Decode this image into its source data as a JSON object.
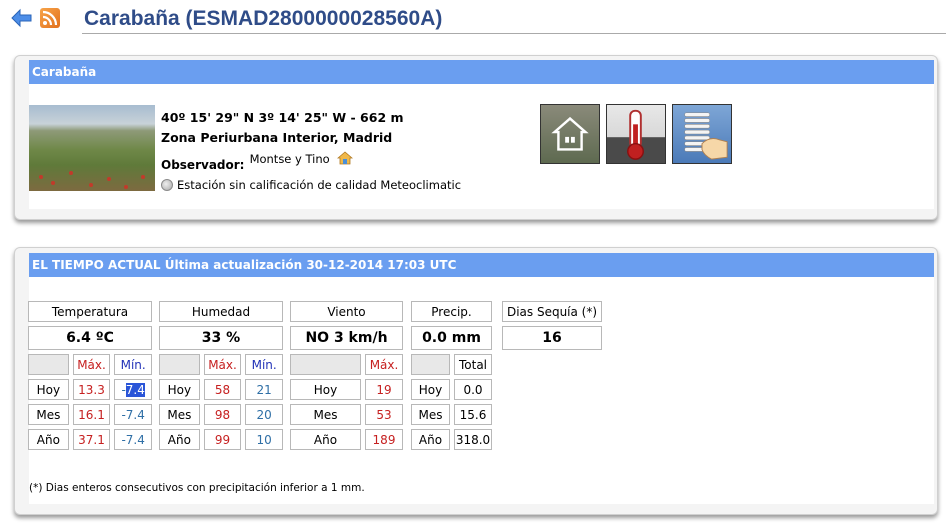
{
  "header": {
    "title": "Carabaña (ESMAD2800000028560A)",
    "back_icon": "back-arrow-icon",
    "rss_icon": "rss-feed-icon"
  },
  "station": {
    "panel_title": "Carabaña",
    "coordinates": "40º 15' 29\" N    3º 14' 25\" W  -  662 m",
    "zone": "Zona Periurbana Interior, Madrid",
    "observer_label": "Observador:",
    "observer_name": "Montse y Tino",
    "quality": "Estación sin calificación de calidad Meteoclimatic",
    "icons": [
      "house-icon",
      "thermometer-icon",
      "radiation-shield-icon"
    ]
  },
  "weather": {
    "panel_title": "EL TIEMPO ACTUAL Última actualización 30-12-2014 17:03 UTC",
    "temperature": {
      "label": "Temperatura",
      "current": "6.4 ºC",
      "max_label": "Máx.",
      "min_label": "Mín.",
      "rows": [
        {
          "period": "Hoy",
          "max": "13.3",
          "min_prefix": "-",
          "min_sel": "7.4"
        },
        {
          "period": "Mes",
          "max": "16.1",
          "min": "-7.4"
        },
        {
          "period": "Año",
          "max": "37.1",
          "min": "-7.4"
        }
      ]
    },
    "humidity": {
      "label": "Humedad",
      "current": "33 %",
      "max_label": "Máx.",
      "min_label": "Mín.",
      "rows": [
        {
          "period": "Hoy",
          "max": "58",
          "min": "21"
        },
        {
          "period": "Mes",
          "max": "98",
          "min": "20"
        },
        {
          "period": "Año",
          "max": "99",
          "min": "10"
        }
      ]
    },
    "wind": {
      "label": "Viento",
      "current": "NO  3 km/h",
      "max_label": "Máx.",
      "rows": [
        {
          "period": "Hoy",
          "max": "19"
        },
        {
          "period": "Mes",
          "max": "53"
        },
        {
          "period": "Año",
          "max": "189"
        }
      ]
    },
    "precip": {
      "label": "Precip.",
      "current": "0.0 mm",
      "total_label": "Total",
      "rows": [
        {
          "period": "Hoy",
          "total": "0.0"
        },
        {
          "period": "Mes",
          "total": "15.6"
        },
        {
          "period": "Año",
          "total": "318.0"
        }
      ]
    },
    "drought": {
      "label": "Dias Sequía (*)",
      "value": "16"
    },
    "footnote": "(*) Dias enteros consecutivos con precipitación inferior a 1 mm."
  },
  "colors": {
    "accent": "#6a9ef0",
    "title": "#2f4c88",
    "max": "#c62020",
    "min": "#2434b8"
  }
}
